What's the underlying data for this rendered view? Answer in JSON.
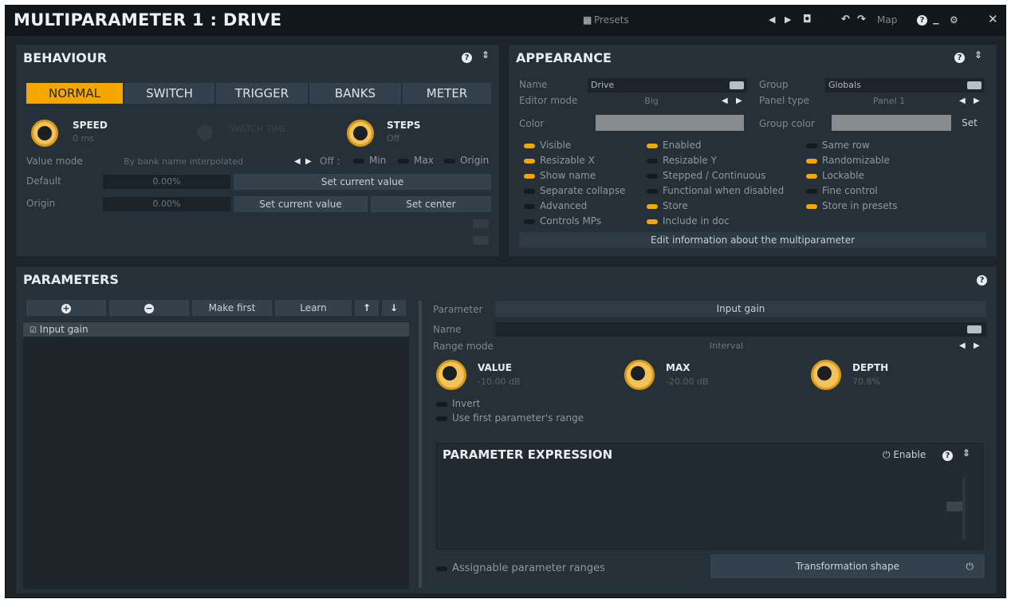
{
  "window": {
    "title": "MULTIPARAMETER 1 : DRIVE",
    "presets": "Presets",
    "map": "Map"
  },
  "behaviour": {
    "title": "BEHAVIOUR",
    "tabs": [
      {
        "label": "NORMAL",
        "active": true
      },
      {
        "label": "SWITCH",
        "active": false
      },
      {
        "label": "TRIGGER",
        "active": false
      },
      {
        "label": "BANKS",
        "active": false
      },
      {
        "label": "METER",
        "active": false
      }
    ],
    "speed": {
      "label": "SPEED",
      "value": "0 ms"
    },
    "switch_time": {
      "label": "SWITCH TIME"
    },
    "steps": {
      "label": "STEPS",
      "value": "Off"
    },
    "value_mode": {
      "label": "Value mode",
      "value": "By bank name interpolated",
      "off": "Off :",
      "min": "Min",
      "max": "Max",
      "origin": "Origin"
    },
    "default": {
      "label": "Default",
      "value": "0.00%",
      "button": "Set current value"
    },
    "origin": {
      "label": "Origin",
      "value": "0.00%",
      "button1": "Set current value",
      "button2": "Set center"
    }
  },
  "appearance": {
    "title": "APPEARANCE",
    "name_label": "Name",
    "name_value": "Drive",
    "group_label": "Group",
    "group_value": "Globals",
    "editor_label": "Editor mode",
    "editor_value": "Big",
    "panel_type_label": "Panel type",
    "panel_type_value": "Panel 1",
    "color_label": "Color",
    "group_color_label": "Group color",
    "set_label": "Set",
    "checks": [
      {
        "label": "Visible",
        "on": true
      },
      {
        "label": "Enabled",
        "on": true
      },
      {
        "label": "Same row",
        "on": false
      },
      {
        "label": "Resizable X",
        "on": true
      },
      {
        "label": "Resizable Y",
        "on": false
      },
      {
        "label": "Randomizable",
        "on": true
      },
      {
        "label": "Show name",
        "on": true
      },
      {
        "label": "Stepped / Continuous",
        "on": false
      },
      {
        "label": "Lockable",
        "on": true
      },
      {
        "label": "Separate collapse",
        "on": false
      },
      {
        "label": "Functional when disabled",
        "on": false
      },
      {
        "label": "Fine control",
        "on": false
      },
      {
        "label": "Advanced",
        "on": false
      },
      {
        "label": "Store",
        "on": true
      },
      {
        "label": "Store in presets",
        "on": true
      },
      {
        "label": "Controls MPs",
        "on": false
      },
      {
        "label": "Include in doc",
        "on": true
      }
    ],
    "edit_info": "Edit information about the multiparameter"
  },
  "parameters": {
    "title": "PARAMETERS",
    "make_first": "Make first",
    "learn": "Learn",
    "list": [
      "Input gain"
    ],
    "parameter_label": "Parameter",
    "parameter_value": "Input gain",
    "name_label": "Name",
    "range_label": "Range mode",
    "range_value": "Interval",
    "value_knob": {
      "label": "VALUE",
      "value": "-10.00 dB"
    },
    "max_knob": {
      "label": "MAX",
      "value": "-20.00 dB"
    },
    "depth_knob": {
      "label": "DEPTH",
      "value": "70.8%"
    },
    "invert": "Invert",
    "use_first": "Use first parameter's range",
    "expression_title": "PARAMETER EXPRESSION",
    "enable": "Enable",
    "assignable": "Assignable parameter ranges",
    "transformation": "Transformation shape"
  },
  "colors": {
    "accent": "#f5a700",
    "background": "#1d252b",
    "panel": "#263039"
  }
}
